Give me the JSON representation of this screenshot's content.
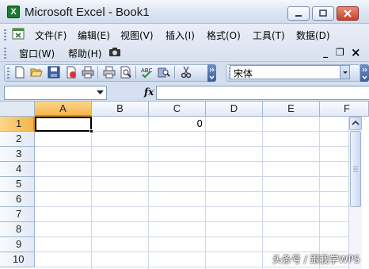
{
  "window": {
    "title": "Microsoft Excel - Book1",
    "app_icon_letter": "X"
  },
  "menubar": {
    "items": [
      {
        "label": "文件(F)"
      },
      {
        "label": "编辑(E)"
      },
      {
        "label": "视图(V)"
      },
      {
        "label": "插入(I)"
      },
      {
        "label": "格式(O)"
      },
      {
        "label": "工具(T)"
      },
      {
        "label": "数据(D)"
      }
    ],
    "row2": [
      {
        "label": "窗口(W)"
      },
      {
        "label": "帮助(H)"
      }
    ],
    "doc_controls": {
      "minimize": "_",
      "restore": "❐",
      "close": "×"
    }
  },
  "toolbar": {
    "font_name": "宋体",
    "buttons": [
      "new-icon",
      "open-icon",
      "save-icon",
      "permission-icon",
      "print-icon",
      "print-preview-icon",
      "spelling-icon",
      "research-icon",
      "cut-icon"
    ]
  },
  "formulabar": {
    "name_box": "",
    "fx_label": "fx",
    "content": ""
  },
  "sheet": {
    "columns": [
      "A",
      "B",
      "C",
      "D",
      "E",
      "F"
    ],
    "rows": [
      "1",
      "2",
      "3",
      "4",
      "5",
      "6",
      "7",
      "8",
      "9",
      "10"
    ],
    "active_cell": "A1",
    "cells": {
      "C1": "0"
    }
  },
  "watermark": "头条号 / 跟我学WPS",
  "colors": {
    "accent": "#f4b64c",
    "title_bg": "#dde6f3",
    "toolbar_bg": "#d4dff0",
    "grid_line": "#d0d7e5"
  }
}
